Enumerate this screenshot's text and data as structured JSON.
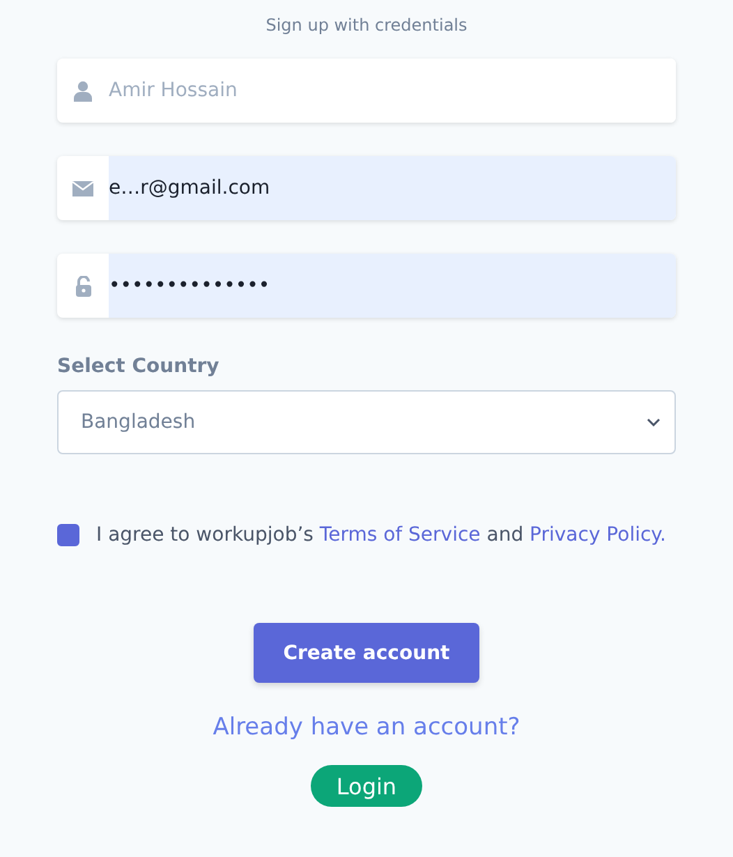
{
  "heading": "Sign up with credentials",
  "fields": [
    {
      "kind": "name",
      "placeholder": "Amir Hossain",
      "autofilled": false
    },
    {
      "kind": "email",
      "value": "e…r@gmail.com",
      "autofilled": true
    },
    {
      "kind": "password",
      "value": "••••••••••••••",
      "autofilled": true
    }
  ],
  "country": {
    "label": "Select Country",
    "value": "Bangladesh"
  },
  "agree": {
    "checked": true,
    "text": "I agree to workupjob’s",
    "terms_link": "Terms of Service",
    "and": "and",
    "privacy_link": "Privacy Policy."
  },
  "create_button": "Create account",
  "login_prompt": "Already have an account?",
  "login_button": "Login"
}
